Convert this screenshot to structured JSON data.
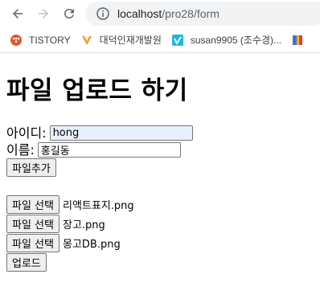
{
  "browser": {
    "url_host": "localhost",
    "url_path": "/pro28/form",
    "bookmarks": [
      {
        "label": "TISTORY",
        "icon": "tistory-icon",
        "color": "#e8542c"
      },
      {
        "label": "대덕인재개발원",
        "icon": "daedeok-icon",
        "color": "#f39a2b"
      },
      {
        "label": "susan9905 (조수경)...",
        "icon": "vimeo-icon",
        "color": "#1ab7ea"
      },
      {
        "label": "",
        "icon": "bookmark-book-icon",
        "color": "#4a6cd4"
      }
    ]
  },
  "page": {
    "title": "파일 업로드 하기",
    "id_label": "아이디:",
    "id_value": "hong",
    "name_label": "이름:",
    "name_value": "홍길동",
    "add_file_button": "파일추가",
    "file_inputs": [
      {
        "button": "파일 선택",
        "filename": "리액트표지.png"
      },
      {
        "button": "파일 선택",
        "filename": "장고.png"
      },
      {
        "button": "파일 선택",
        "filename": "몽고DB.png"
      }
    ],
    "upload_button": "업로드"
  }
}
